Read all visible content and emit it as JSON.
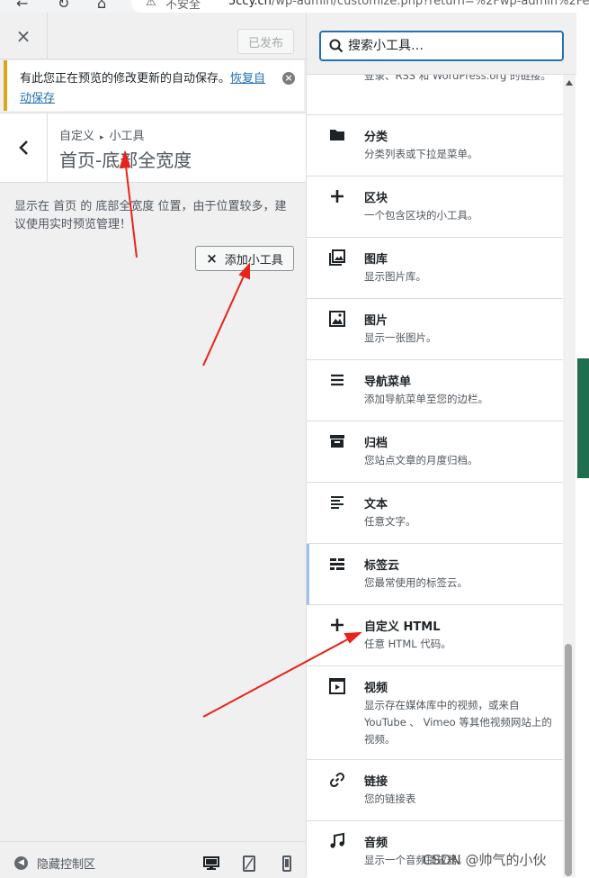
{
  "browser": {
    "back_icon": "arrow-left-icon",
    "refresh_icon": "refresh-icon",
    "home_icon": "home-icon",
    "security_text": "不安全",
    "url_host": "5ccy.cn",
    "url_path": "/wp-admin/customize.php?return=%2Fwp-admin%2Fedit."
  },
  "topbar": {
    "close_label": "×",
    "publish_label": "已发布"
  },
  "notice": {
    "text": "有此您正在预览的修改更新的自动保存。",
    "restore_link": "恢复自动保存",
    "dismiss": "×"
  },
  "section": {
    "breadcrumb_root": "自定义",
    "breadcrumb_sep": "▸",
    "breadcrumb_current": "小工具",
    "title": "首页-底部全宽度",
    "description": "显示在 首页 的 底部全宽度 位置，由于位置较多，建议使用实时预览管理！",
    "add_widget_label": "添加小工具",
    "add_widget_icon": "×"
  },
  "footer": {
    "collapse_label": "隐藏控制区",
    "devices": [
      "desktop",
      "tablet",
      "mobile"
    ]
  },
  "chooser": {
    "search_placeholder": "搜索小工具…",
    "widgets": [
      {
        "name": "",
        "desc": "登录、RSS 和 WordPress.org 的链接。",
        "icon": "partial"
      },
      {
        "name": "分类",
        "desc": "分类列表或下拉是菜单。",
        "icon": "folder-icon"
      },
      {
        "name": "区块",
        "desc": "一个包含区块的小工具。",
        "icon": "plus-icon"
      },
      {
        "name": "图库",
        "desc": "显示图片库。",
        "icon": "gallery-icon"
      },
      {
        "name": "图片",
        "desc": "显示一张图片。",
        "icon": "image-icon"
      },
      {
        "name": "导航菜单",
        "desc": "添加导航菜单至您的边栏。",
        "icon": "menu-icon"
      },
      {
        "name": "归档",
        "desc": "您站点文章的月度归档。",
        "icon": "archive-icon"
      },
      {
        "name": "文本",
        "desc": "任意文字。",
        "icon": "text-icon"
      },
      {
        "name": "标签云",
        "desc": "您最常使用的标签云。",
        "icon": "tag-cloud-icon"
      },
      {
        "name": "自定义 HTML",
        "desc": "任意 HTML 代码。",
        "icon": "plus-icon"
      },
      {
        "name": "视频",
        "desc": "显示存在媒体库中的视频，或来自 YouTube 、 Vimeo 等其他视频网站上的视频。",
        "icon": "video-icon"
      },
      {
        "name": "链接",
        "desc": "您的链接表",
        "icon": "link-icon"
      },
      {
        "name": "音频",
        "desc": "显示一个音频播放器。",
        "icon": "music-icon"
      }
    ]
  },
  "colors": {
    "accent": "#2271b1",
    "notice_border": "#dba617",
    "arrow": "#e8231a"
  },
  "watermark": "CSDN @帅气的小伙"
}
